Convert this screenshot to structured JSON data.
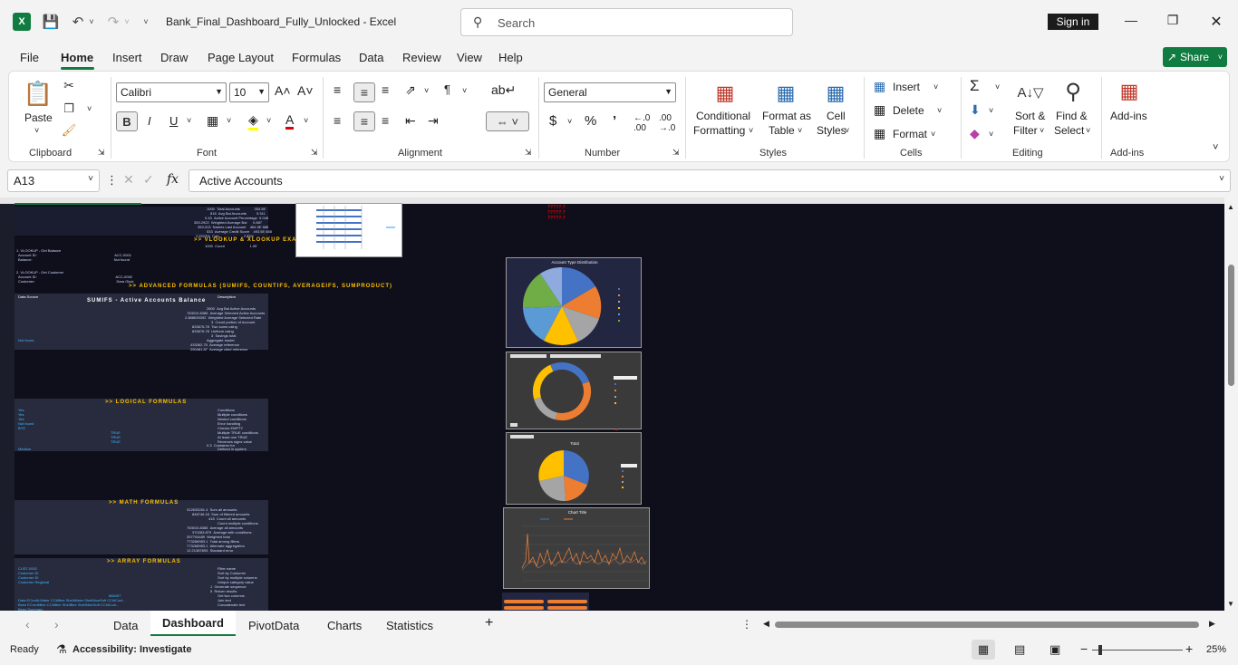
{
  "window": {
    "title": "Bank_Final_Dashboard_Fully_Unlocked  -  Excel",
    "search_placeholder": "Search",
    "sign_in": "Sign in"
  },
  "menu": [
    "File",
    "Home",
    "Insert",
    "Draw",
    "Page Layout",
    "Formulas",
    "Data",
    "Review",
    "View",
    "Help"
  ],
  "share_label": "Share",
  "ribbon": {
    "clipboard": {
      "paste": "Paste",
      "label": "Clipboard"
    },
    "font": {
      "name": "Calibri",
      "size": "10",
      "label": "Font"
    },
    "alignment": {
      "label": "Alignment"
    },
    "number": {
      "format": "General",
      "label": "Number"
    },
    "styles": {
      "conditional_1": "Conditional",
      "conditional_2": "Formatting",
      "format_as_1": "Format as",
      "format_as_2": "Table",
      "cell_1": "Cell",
      "cell_2": "Styles",
      "label": "Styles"
    },
    "cells": {
      "insert": "Insert",
      "delete": "Delete",
      "format": "Format",
      "label": "Cells"
    },
    "editing": {
      "sort_1": "Sort &",
      "sort_2": "Filter",
      "find_1": "Find &",
      "find_2": "Select",
      "label": "Editing"
    },
    "addins": {
      "btn": "Add-ins",
      "label": "Add-ins"
    }
  },
  "formula_bar": {
    "cell_ref": "A13",
    "content": "Active Accounts"
  },
  "sheet": {
    "headers": [
      ">> VLOOKUP & XLOOKUP EXAMP",
      ">> ADVANCED FORMULAS (SUMIFS, COUNTIFS, AVERAGEIFS, SUMPRODUCT)",
      "SUMIFS - Active Accounts Balance",
      ">> LOGICAL FORMULAS",
      ">> MATH FORMULAS",
      ">> ARRAY FORMULAS"
    ],
    "chart_titles": [
      "Account Type Distribution",
      "Total",
      "Chart Title"
    ]
  },
  "tabs": [
    "Data",
    "Dashboard",
    "PivotData",
    "Charts",
    "Statistics"
  ],
  "status": {
    "ready": "Ready",
    "accessibility": "Accessibility: Investigate",
    "zoom": "25%"
  },
  "colors": {
    "excel_green": "#107c41",
    "sheet_bg": "#0e0f1b",
    "panel": "#272b3d",
    "header_gold": "#ffc000"
  }
}
